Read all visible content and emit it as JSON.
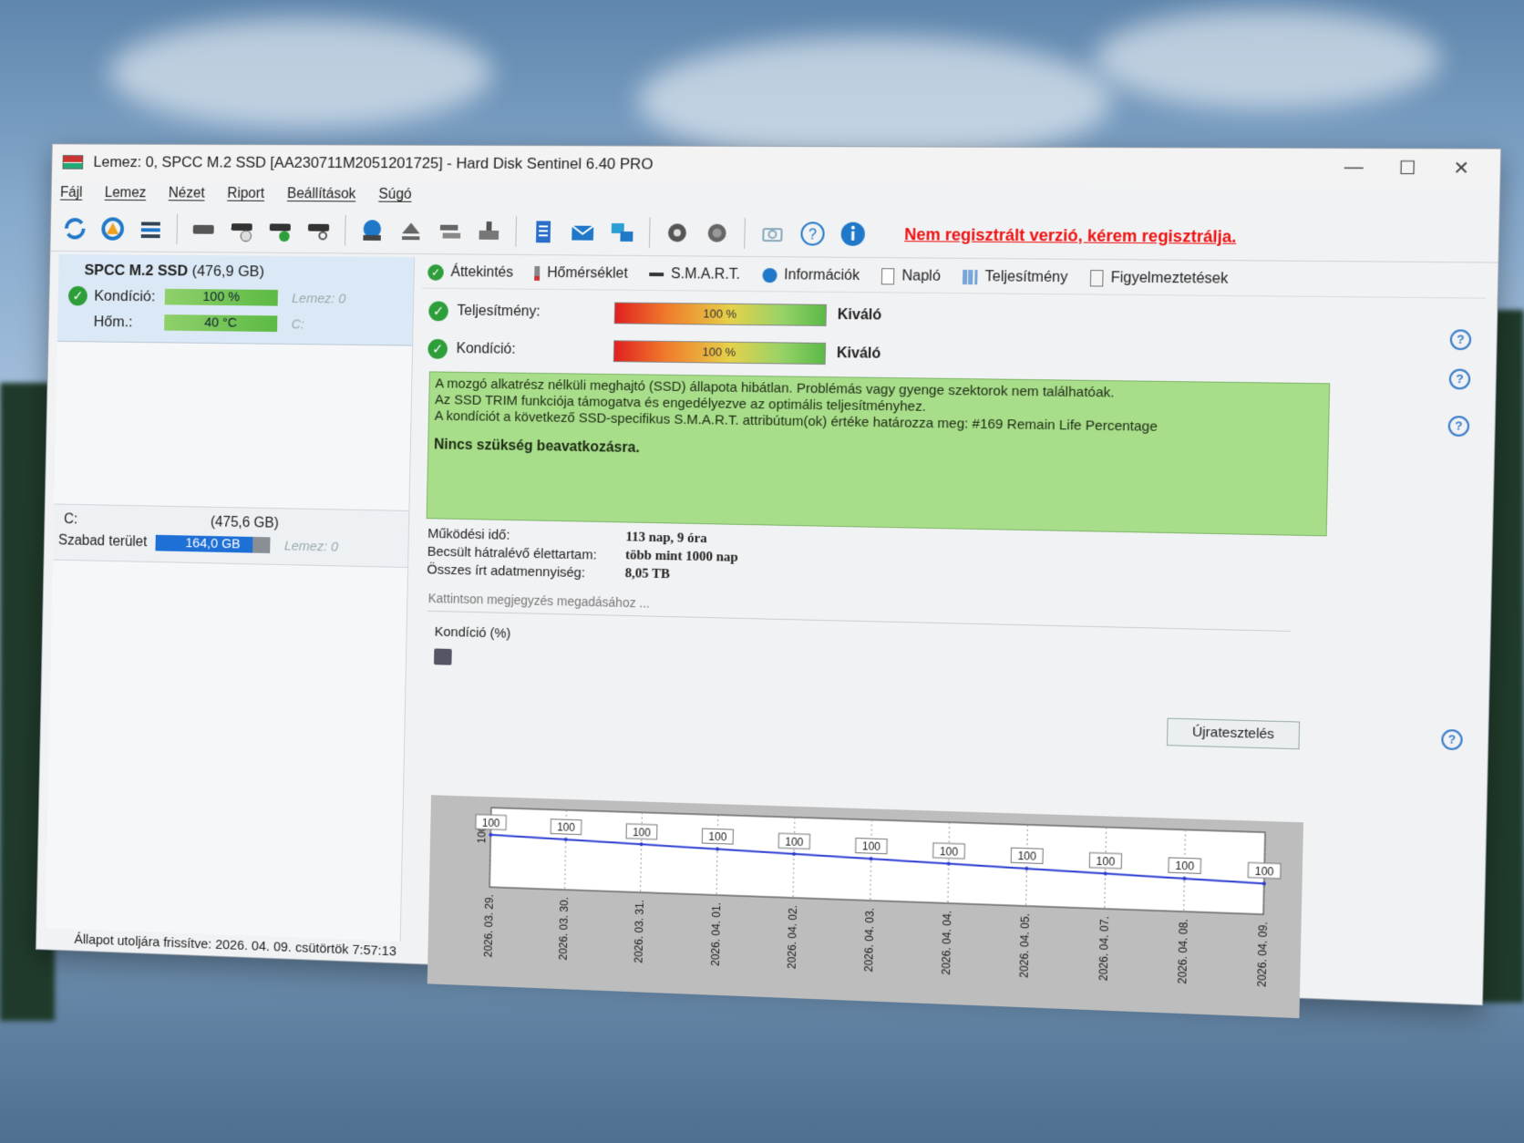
{
  "window": {
    "title": "Lemez: 0, SPCC M.2 SSD [AA230711M2051201725]  -  Hard Disk Sentinel 6.40 PRO",
    "min_glyph": "—",
    "max_glyph": "☐",
    "close_glyph": "✕"
  },
  "menu": [
    "Fájl",
    "Lemez",
    "Nézet",
    "Riport",
    "Beállítások",
    "Súgó"
  ],
  "toolbar": {
    "unregistered_note": "Nem regisztrált verzió, kérem regisztrálja.",
    "icons": [
      "refresh-icon",
      "refresh-warning-icon",
      "disk-list-icon",
      "disk-icon",
      "disk-clock-icon",
      "disk-check-icon",
      "disk-search-icon",
      "globe-disk-icon",
      "eject-icon",
      "disk-stack-icon",
      "disk-export-icon",
      "report-icon",
      "mail-icon",
      "network-icon",
      "settings-icon",
      "alert-settings-icon",
      "camera-icon",
      "help-icon",
      "info-icon"
    ]
  },
  "left_panel": {
    "disk_name": "SPCC M.2 SSD",
    "disk_size": "(476,9 GB)",
    "condition_label": "Kondíció:",
    "condition_value": "100 %",
    "condition_ghost": "Lemez: 0",
    "temp_label": "Hőm.:",
    "temp_value": "40 °C",
    "temp_ghost": "C:",
    "partition_letter": "C:",
    "partition_size": "(475,6 GB)",
    "free_label": "Szabad terület",
    "free_value": "164,0 GB",
    "free_ghost": "Lemez: 0",
    "status_bar": "Állapot utoljára frissítve: 2026. 04. 09. csütörtök 7:57:13"
  },
  "tabs": [
    "Áttekintés",
    "Hőmérséklet",
    "S.M.A.R.T.",
    "Információk",
    "Napló",
    "Teljesítmény",
    "Figyelmeztetések"
  ],
  "overview": {
    "performance_label": "Teljesítmény:",
    "performance_value": "100 %",
    "performance_verdict": "Kiváló",
    "condition_label": "Kondíció:",
    "condition_value": "100 %",
    "condition_verdict": "Kiváló",
    "message_line1": "A mozgó alkatrész nélküli meghajtó (SSD) állapota hibátlan. Problémás vagy gyenge szektorok nem találhatóak.",
    "message_line2": "Az SSD TRIM funkciója támogatva és engedélyezve az optimális teljesítményhez.",
    "message_line3": "A kondíciót a következő SSD-specifikus S.M.A.R.T. attribútum(ok) értéke határozza meg:  #169 Remain Life Percentage",
    "message_action": "Nincs szükség beavatkozásra.",
    "uptime_label": "Működési idő:",
    "uptime_value": "113 nap, 9 óra",
    "lifetime_label": "Becsült hátralévő élettartam:",
    "lifetime_value": "több mint 1000 nap",
    "written_label": "Összes írt adatmennyiség:",
    "written_value": "8,05 TB",
    "retest_button": "Újratesztelés",
    "note_placeholder": "Kattintson megjegyzés megadásához ...",
    "chart_title": "Kondíció  (%)",
    "help_glyph": "?"
  },
  "chart_data": {
    "type": "line",
    "title": "Kondíció  (%)",
    "x": [
      "2026. 03. 29.",
      "2026. 03. 30.",
      "2026. 03. 31.",
      "2026. 04. 01.",
      "2026. 04. 02.",
      "2026. 04. 03.",
      "2026. 04. 04.",
      "2026. 04. 05.",
      "2026. 04. 07.",
      "2026. 04. 08.",
      "2026. 04. 09."
    ],
    "series": [
      {
        "values": [
          100,
          100,
          100,
          100,
          100,
          100,
          100,
          100,
          100,
          100,
          100
        ]
      }
    ],
    "y_tick": "100",
    "line_color": "#2b3bd1",
    "grid": true
  }
}
